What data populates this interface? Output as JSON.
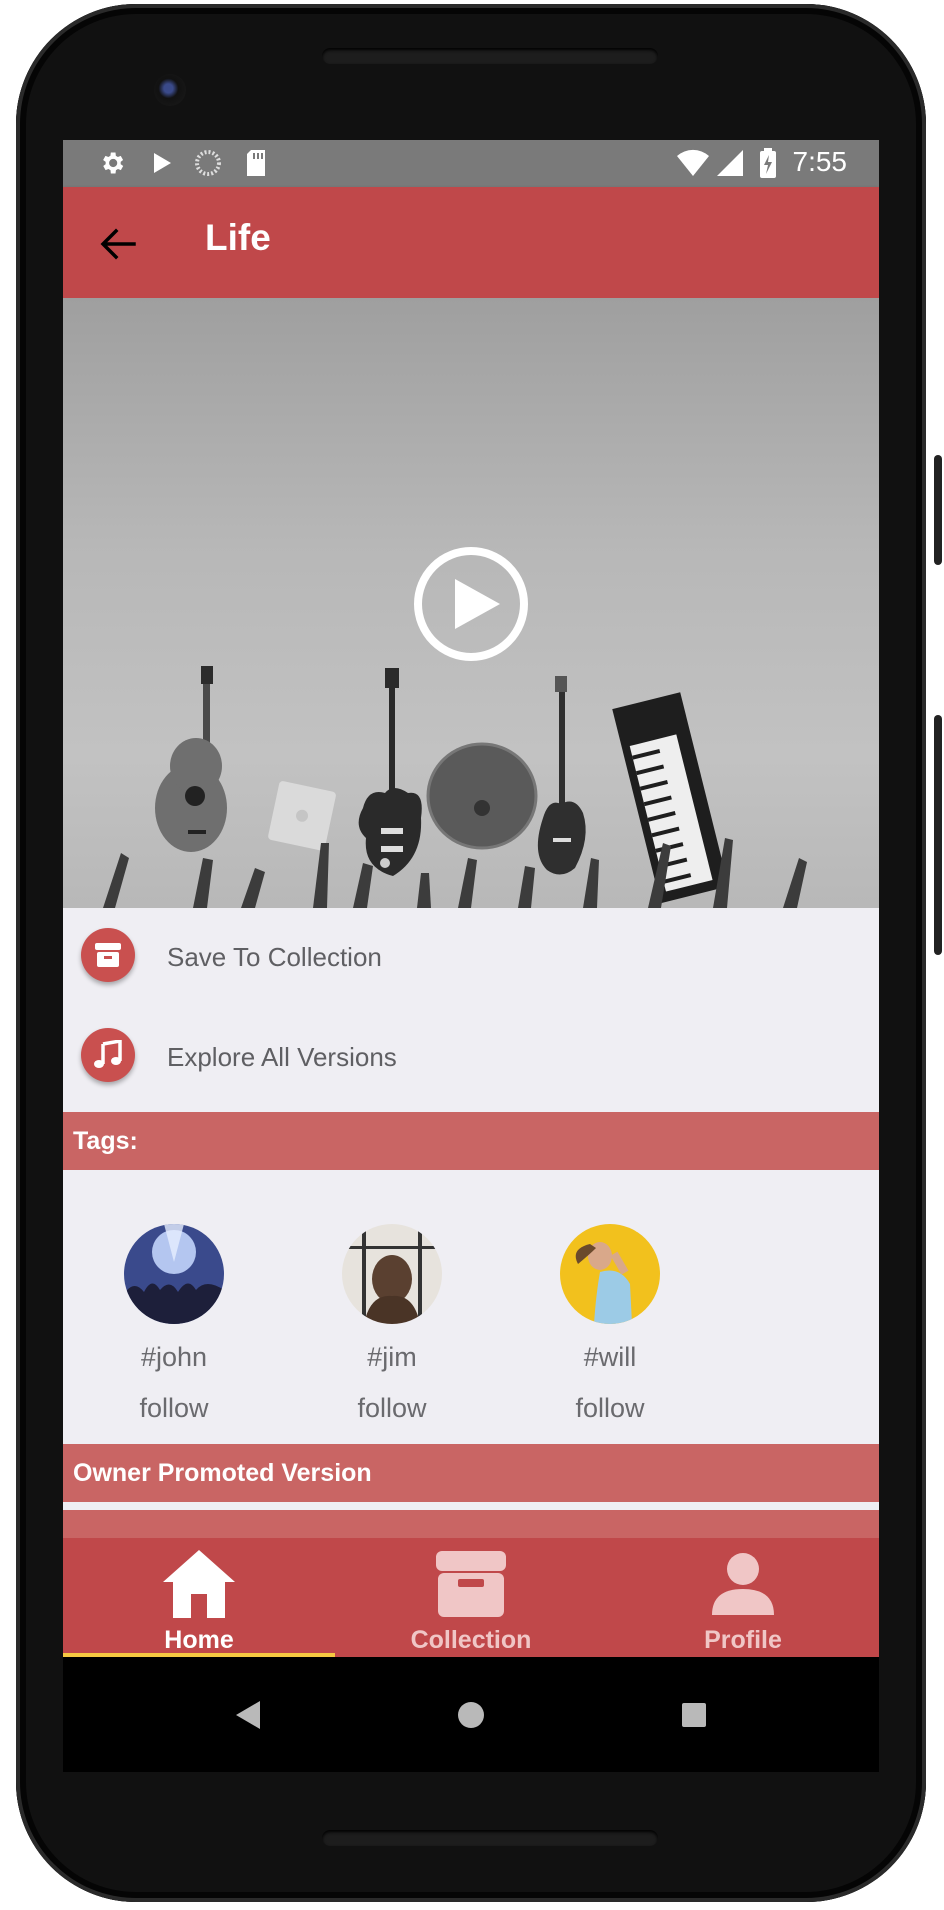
{
  "status_bar": {
    "time": "7:55",
    "left_icons": [
      "gear-icon",
      "play-icon",
      "loading-icon",
      "sd-card-icon"
    ],
    "right_icons": [
      "wifi-icon",
      "signal-icon",
      "battery-charging-icon"
    ]
  },
  "app_bar": {
    "title": "Life",
    "back_icon": "arrow-left-icon"
  },
  "hero": {
    "play_icon": "play-circle-icon"
  },
  "actions": [
    {
      "label": "Save To Collection",
      "icon": "archive-box-icon"
    },
    {
      "label": "Explore All Versions",
      "icon": "music-note-icon"
    }
  ],
  "tags_section": {
    "header": "Tags:",
    "items": [
      {
        "name": "#john",
        "follow": "follow"
      },
      {
        "name": "#jim",
        "follow": "follow"
      },
      {
        "name": "#will",
        "follow": "follow"
      }
    ]
  },
  "owner_section": {
    "header": "Owner Promoted Version"
  },
  "bottom_nav": {
    "items": [
      {
        "label": "Home",
        "icon": "home-icon",
        "active": true
      },
      {
        "label": "Collection",
        "icon": "archive-box-icon",
        "active": false
      },
      {
        "label": "Profile",
        "icon": "person-icon",
        "active": false
      }
    ]
  },
  "colors": {
    "primary": "#c0484a",
    "section_header": "#c96564",
    "active_indicator": "#f5c842",
    "inactive_nav_text": "#f0c6c6"
  }
}
